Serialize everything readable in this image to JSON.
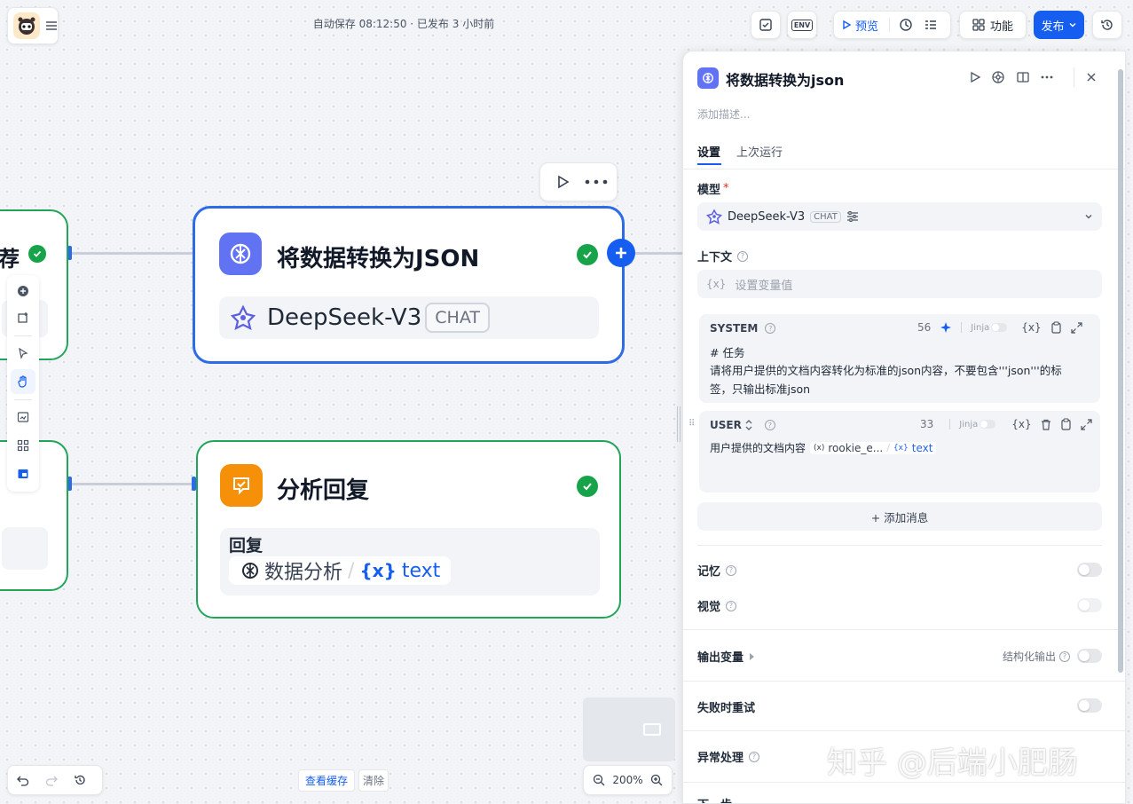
{
  "topbar": {
    "autosave_text": "自动保存 08:12:50 · 已发布 3 小时前",
    "env_label": "ENV",
    "preview_label": "预览",
    "features_label": "功能",
    "publish_label": "发布"
  },
  "nodes": {
    "left_partial_title": "荐",
    "json_node": {
      "title": "将数据转换为JSON",
      "model": "DeepSeek-V3",
      "model_tag": "CHAT"
    },
    "analysis_node": {
      "title": "分析回复",
      "reply_label": "回复",
      "var_source": "数据分析",
      "var_sep": "/",
      "var_name": "text",
      "var_icon": "{x}"
    }
  },
  "panel": {
    "title": "将数据转换为json",
    "desc_placeholder": "添加描述...",
    "tabs": [
      "设置",
      "上次运行"
    ],
    "model_label": "模型",
    "required_mark": "*",
    "model_name": "DeepSeek-V3",
    "model_tag": "CHAT",
    "context_label": "上下文",
    "context_placeholder": "设置变量值",
    "context_icon": "{x}",
    "system": {
      "role": "SYSTEM",
      "count": "56",
      "jinja": "Jinja",
      "var_icon": "{x}",
      "line1": "# 任务",
      "line2": "请将用户提供的文档内容转化为标准的json内容，不要包含'''json'''的标签，只输出标准json"
    },
    "user": {
      "role": "USER",
      "count": "33",
      "jinja": "Jinja",
      "var_icon": "{x}",
      "text": "用户提供的文档内容",
      "var1": "rookie_e...",
      "var_sep": "/",
      "var2": "text"
    },
    "add_message": "+ 添加消息",
    "memory_label": "记忆",
    "vision_label": "视觉",
    "output_label": "输出变量",
    "structured_label": "结构化输出",
    "retry_label": "失败时重试",
    "error_label": "异常处理",
    "next_label": "下一步"
  },
  "bottom": {
    "view_cache": "查看缓存",
    "clear": "清除",
    "zoom": "200%"
  },
  "watermark": "知乎 @后端小肥肠",
  "colors": {
    "accent": "#155eef",
    "success": "#16a34a",
    "node_blue": "#2e6be6",
    "node_green": "#22a55b",
    "orange": "#f79009",
    "indigo": "#6172f3"
  }
}
